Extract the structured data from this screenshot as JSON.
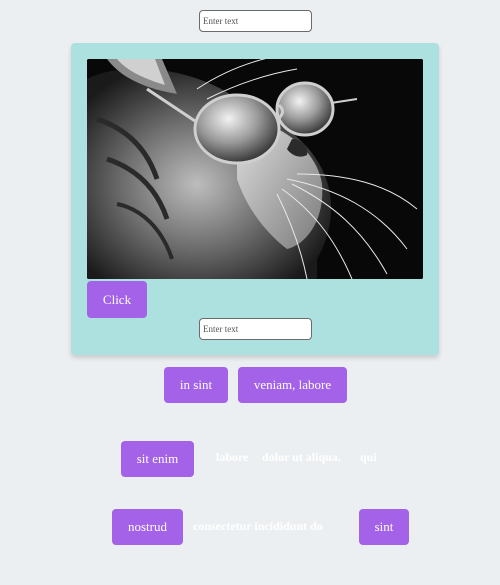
{
  "top_input": {
    "placeholder": "Enter text",
    "value": ""
  },
  "card": {
    "image_alt": "cat wearing sunglasses",
    "button_label": "Click",
    "input": {
      "placeholder": "Enter text",
      "value": ""
    }
  },
  "row1": {
    "buttons": [
      "in sint",
      "veniam, labore"
    ]
  },
  "row2": {
    "button": "sit enim",
    "texts": [
      "labore",
      "dolor ut aliqua.",
      "qui"
    ]
  },
  "row3": {
    "button_left": "nostrud",
    "text": "consectetur incididunt do",
    "button_right": "sint"
  },
  "colors": {
    "background": "#eceff1",
    "card": "#ace1df",
    "button": "#a362e8",
    "button_text": "#ffffff"
  }
}
